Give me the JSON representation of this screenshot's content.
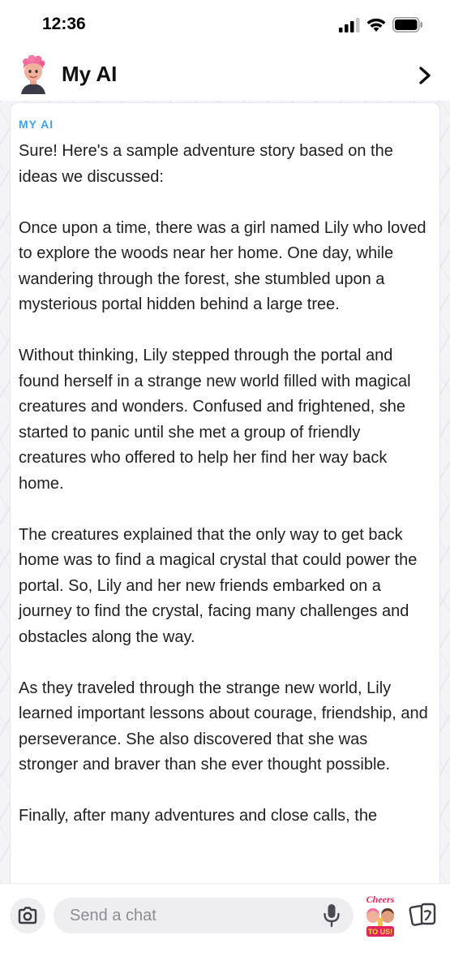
{
  "status_bar": {
    "time": "12:36",
    "signal_icon": "cellular-signal-icon",
    "wifi_icon": "wifi-icon",
    "battery_icon": "battery-icon"
  },
  "header": {
    "title": "My AI",
    "avatar_icon": "my-ai-avatar",
    "chevron_icon": "chevron-right-icon"
  },
  "message": {
    "sender": "MY AI",
    "paragraphs": [
      "Sure! Here's a sample adventure story based on the ideas we discussed:",
      "Once upon a time, there was a girl named Lily who loved to explore the woods near her home. One day, while wandering through the forest, she stumbled upon a mysterious portal hidden behind a large tree.",
      "Without thinking, Lily stepped through the portal and found herself in a strange new world filled with magical creatures and wonders. Confused and frightened, she started to panic until she met a group of friendly creatures who offered to help her find her way back home.",
      "The creatures explained that the only way to get back home was to find a magical crystal that could power the portal. So, Lily and her new friends embarked on a journey to find the crystal, facing many challenges and obstacles along the way.",
      "As they traveled through the strange new world, Lily learned important lessons about courage, friendship, and perseverance. She also discovered that she was stronger and braver than she ever thought possible.",
      "Finally, after many adventures and close calls, the"
    ]
  },
  "composer": {
    "placeholder": "Send a chat",
    "camera_icon": "camera-icon",
    "mic_icon": "microphone-icon",
    "sticker_text_top": "Cheers",
    "sticker_text_bottom": "TO US!",
    "sticker_picker_icon": "sticker-picker-icon"
  },
  "colors": {
    "accent_label": "#40a4e6",
    "chat_background": "#f4f4f6",
    "input_background": "#eeeef1"
  }
}
